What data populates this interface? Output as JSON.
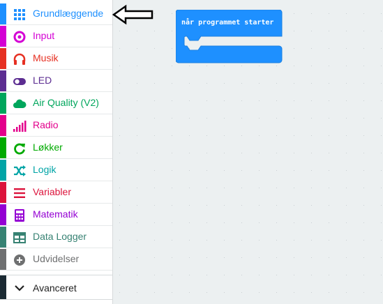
{
  "toolbox": {
    "categories": [
      {
        "label": "Grundlæggende",
        "color": "#1e90ff",
        "icon": "grid-icon"
      },
      {
        "label": "Input",
        "color": "#d400d4",
        "icon": "target-icon"
      },
      {
        "label": "Musik",
        "color": "#e63022",
        "icon": "headphones-icon"
      },
      {
        "label": "LED",
        "color": "#5c2d91",
        "icon": "toggle-icon"
      },
      {
        "label": "Air Quality (V2)",
        "color": "#00a65c",
        "icon": "cloud-icon"
      },
      {
        "label": "Radio",
        "color": "#e3008c",
        "icon": "signal-bars-icon"
      },
      {
        "label": "Løkker",
        "color": "#00aa00",
        "icon": "refresh-icon"
      },
      {
        "label": "Logik",
        "color": "#00a4a6",
        "icon": "shuffle-icon"
      },
      {
        "label": "Variabler",
        "color": "#dc143c",
        "icon": "lines-icon"
      },
      {
        "label": "Matematik",
        "color": "#9400d3",
        "icon": "calculator-icon"
      },
      {
        "label": "Data Logger",
        "color": "#378273",
        "icon": "table-icon"
      },
      {
        "label": "Udvidelser",
        "color": "#6f7071",
        "icon": "plus-circle-icon"
      }
    ],
    "advanced": {
      "label": "Avanceret",
      "icon": "chevron-down-icon"
    }
  },
  "workspace": {
    "block": {
      "label": "når programmet starter",
      "color": "#1e90ff"
    }
  }
}
